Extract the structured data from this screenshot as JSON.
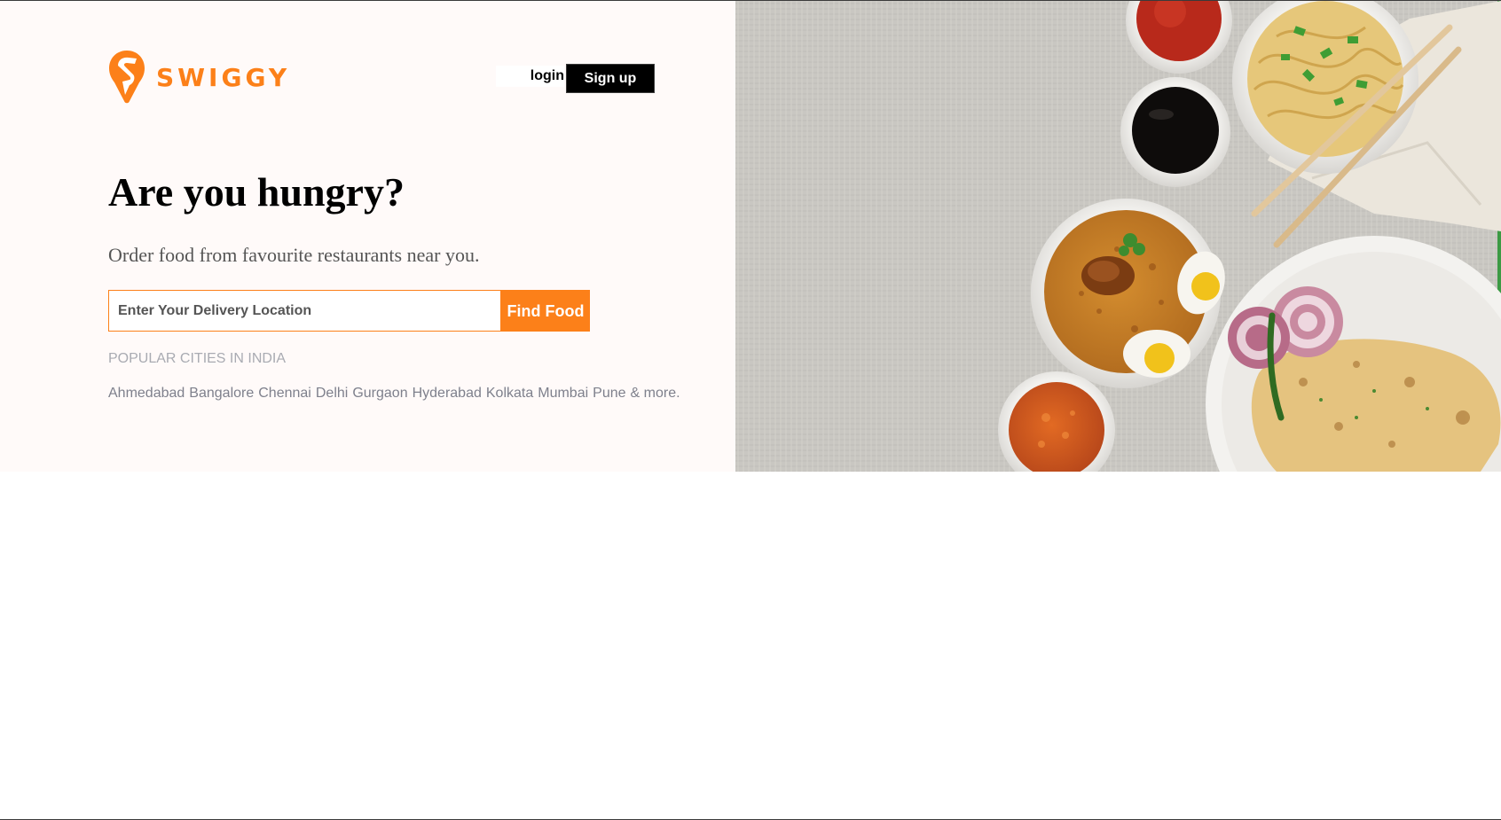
{
  "brand": {
    "name": "SWIGGY",
    "accent_color": "#fc8019",
    "logo_icon": "swiggy-pin-icon"
  },
  "header": {
    "login_label": "login",
    "signup_label": "Sign up"
  },
  "hero": {
    "headline": "Are you hungry?",
    "subheading": "Order food from favourite restaurants near you.",
    "search": {
      "placeholder": "Enter Your Delivery Location",
      "value": "",
      "button_label": "Find Food"
    },
    "cities_title": "POPULAR CITIES IN INDIA",
    "cities": [
      "Ahmedabad",
      "Bangalore",
      "Chennai",
      "Delhi",
      "Gurgaon",
      "Hyderabad",
      "Kolkata",
      "Mumbai",
      "Pune",
      "& more."
    ]
  },
  "hero_image": {
    "description_icon": "food-spread-image"
  }
}
